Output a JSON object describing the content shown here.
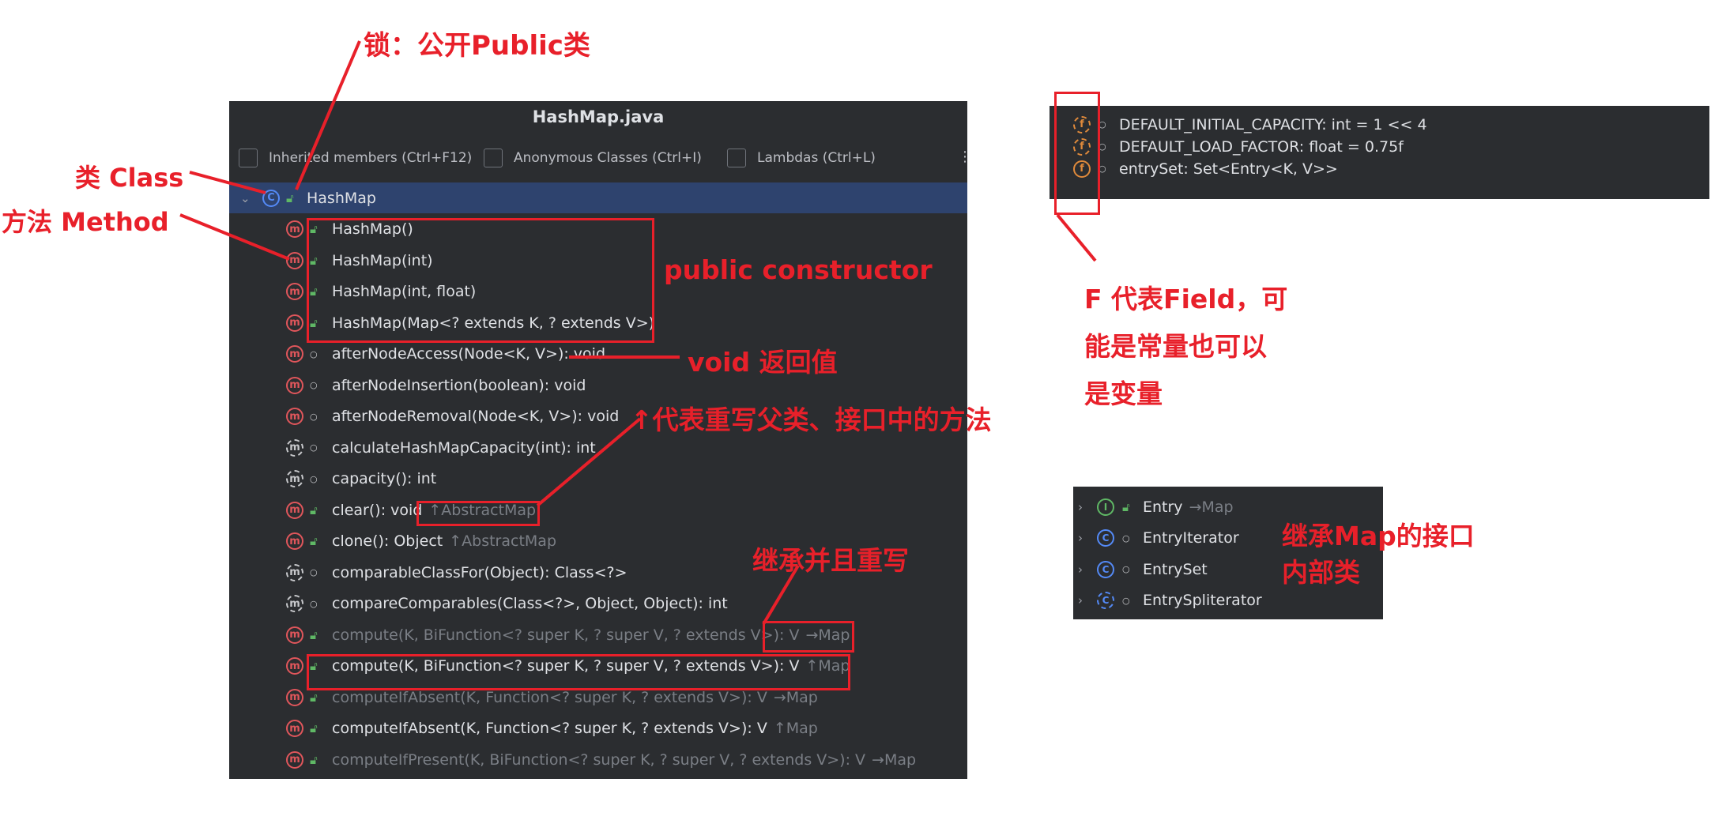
{
  "panel": {
    "title": "HashMap.java",
    "checkboxes": [
      {
        "label": "Inherited members (Ctrl+F12)"
      },
      {
        "label": "Anonymous Classes (Ctrl+I)"
      },
      {
        "label": "Lambdas (Ctrl+L)"
      }
    ],
    "more": "⋮",
    "class_row": {
      "label": "HashMap",
      "kind_icon": "class-icon",
      "visibility": "public"
    },
    "members": [
      {
        "label": "HashMap()",
        "visibility": "public",
        "kind": "method",
        "dim": false,
        "super": ""
      },
      {
        "label": "HashMap(int)",
        "visibility": "public",
        "kind": "method",
        "dim": false,
        "super": ""
      },
      {
        "label": "HashMap(int, float)",
        "visibility": "public",
        "kind": "method",
        "dim": false,
        "super": ""
      },
      {
        "label": "HashMap(Map<? extends K, ? extends V>)",
        "visibility": "public",
        "kind": "method",
        "dim": false,
        "super": ""
      },
      {
        "label": "afterNodeAccess(Node<K, V>): void",
        "visibility": "package",
        "kind": "method",
        "dim": false,
        "super": ""
      },
      {
        "label": "afterNodeInsertion(boolean): void",
        "visibility": "package",
        "kind": "method",
        "dim": false,
        "super": ""
      },
      {
        "label": "afterNodeRemoval(Node<K, V>): void",
        "visibility": "package",
        "kind": "method",
        "dim": false,
        "super": ""
      },
      {
        "label": "calculateHashMapCapacity(int): int",
        "visibility": "package",
        "kind": "static-method",
        "dim": false,
        "super": ""
      },
      {
        "label": "capacity(): int",
        "visibility": "package",
        "kind": "static-method",
        "dim": false,
        "super": ""
      },
      {
        "label": "clear(): void",
        "visibility": "public",
        "kind": "method",
        "dim": false,
        "super": "↑AbstractMap"
      },
      {
        "label": "clone(): Object",
        "visibility": "public",
        "kind": "method",
        "dim": false,
        "super": "↑AbstractMap"
      },
      {
        "label": "comparableClassFor(Object): Class<?>",
        "visibility": "package",
        "kind": "static-method",
        "dim": false,
        "super": ""
      },
      {
        "label": "compareComparables(Class<?>, Object, Object): int",
        "visibility": "package",
        "kind": "static-method",
        "dim": false,
        "super": ""
      },
      {
        "label": "compute(K, BiFunction<? super K, ? super V, ? extends V>): V",
        "visibility": "public",
        "kind": "method",
        "dim": true,
        "super": "→Map"
      },
      {
        "label": "compute(K, BiFunction<? super K, ? super V, ? extends V>): V",
        "visibility": "public",
        "kind": "method",
        "dim": false,
        "super": "↑Map"
      },
      {
        "label": "computeIfAbsent(K, Function<? super K, ? extends V>): V",
        "visibility": "public",
        "kind": "method",
        "dim": true,
        "super": "→Map"
      },
      {
        "label": "computeIfAbsent(K, Function<? super K, ? extends V>): V",
        "visibility": "public",
        "kind": "method",
        "dim": false,
        "super": "↑Map"
      },
      {
        "label": "computeIfPresent(K, BiFunction<? super K, ? super V, ? extends V>): V",
        "visibility": "public",
        "kind": "method",
        "dim": true,
        "super": "→Map"
      }
    ]
  },
  "fields": [
    {
      "label": "DEFAULT_INITIAL_CAPACITY: int = 1 << 4",
      "kind": "static-field"
    },
    {
      "label": "DEFAULT_LOAD_FACTOR: float = 0.75f",
      "kind": "static-field"
    },
    {
      "label": "entrySet: Set<Entry<K, V>>",
      "kind": "field"
    }
  ],
  "inner": [
    {
      "label": "Entry",
      "super": "→Map",
      "kind": "interface",
      "visibility": "public"
    },
    {
      "label": "EntryIterator",
      "super": "",
      "kind": "class",
      "visibility": "package"
    },
    {
      "label": "EntrySet",
      "super": "",
      "kind": "class",
      "visibility": "package"
    },
    {
      "label": "EntrySpliterator",
      "super": "",
      "kind": "static-class",
      "visibility": "package"
    }
  ],
  "annotations": {
    "lock": "锁：公开Public类",
    "class": "类 Class",
    "method": "方法 Method",
    "public_constructor": "public constructor",
    "void_return": "void 返回值",
    "override": "↑代表重写父类、接口中的方法",
    "inherit_override": "继承并且重写",
    "field_line1": "F 代表Field，可",
    "field_line2": "能是常量也可以",
    "field_line3": "是变量",
    "inner_line1": "继承Map的接口",
    "inner_line2": "内部类"
  },
  "colors": {
    "annotation": "#e8202a",
    "panel_bg": "#2b2d30",
    "selected_bg": "#2e436e",
    "method_icon": "#e0565b",
    "class_icon": "#548af7",
    "field_icon": "#e08a3b",
    "public_icon": "#5fb865"
  }
}
